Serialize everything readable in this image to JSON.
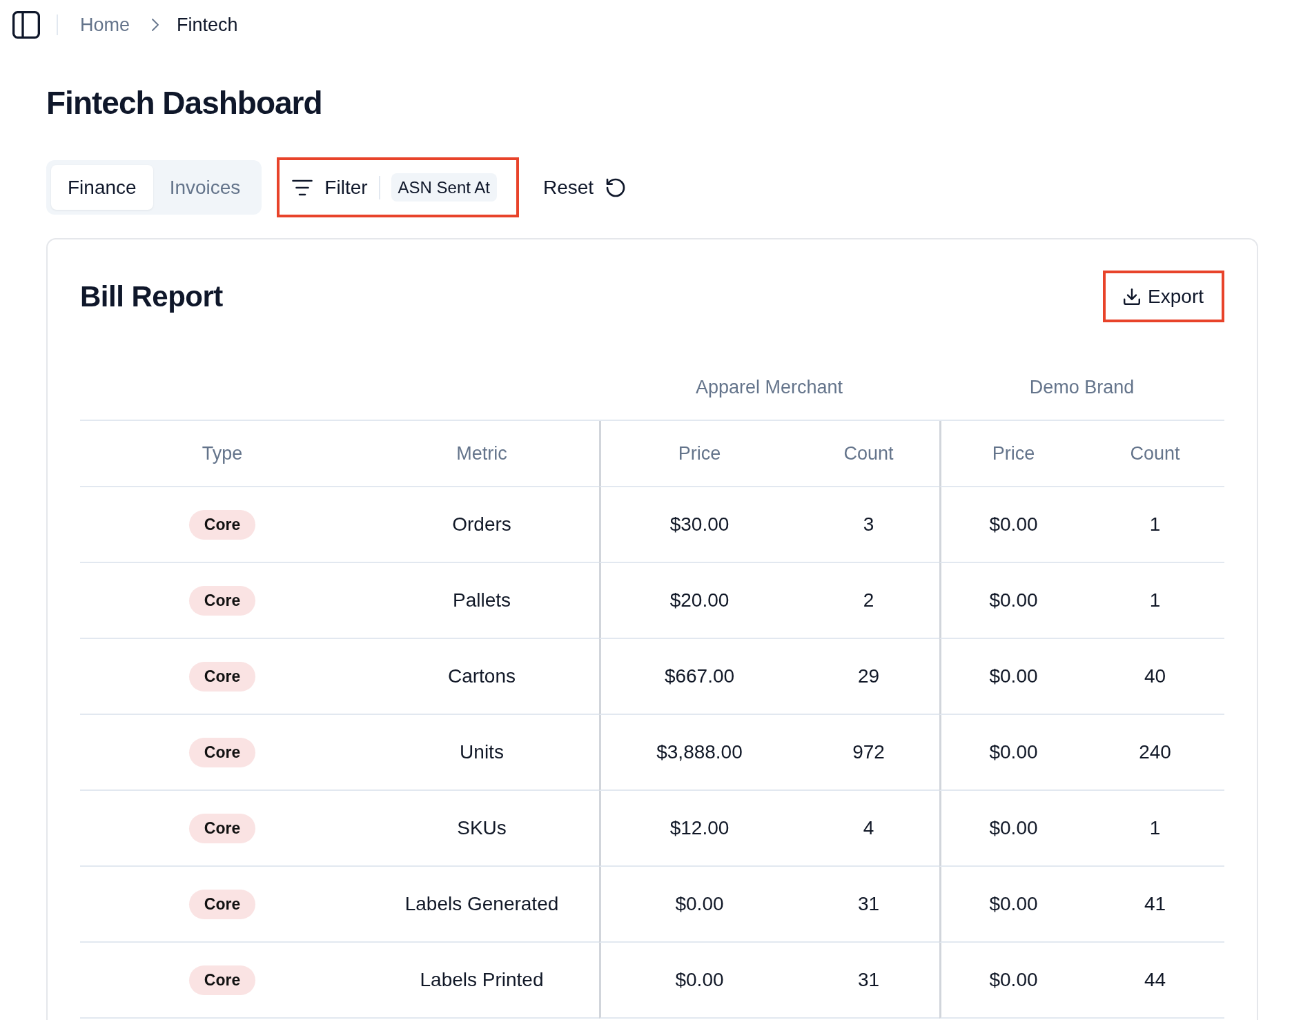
{
  "breadcrumb": [
    {
      "label": "Home",
      "current": false
    },
    {
      "label": "Fintech",
      "current": true
    }
  ],
  "page_title": "Fintech Dashboard",
  "tabs": [
    {
      "label": "Finance",
      "selected": true
    },
    {
      "label": "Invoices",
      "selected": false
    }
  ],
  "filter": {
    "label": "Filter",
    "chips": [
      "ASN Sent At"
    ],
    "highlighted": true
  },
  "reset_button": {
    "label": "Reset"
  },
  "report": {
    "title": "Bill Report",
    "export_button": {
      "label": "Export",
      "highlighted": true
    },
    "table": {
      "columns": [
        "Type",
        "Metric"
      ],
      "column_groups": [
        {
          "label": "Apparel Merchant",
          "columns": [
            "Price",
            "Count"
          ]
        },
        {
          "label": "Demo Brand",
          "columns": [
            "Price",
            "Count"
          ]
        }
      ],
      "rows": [
        {
          "type": "Core",
          "metric": "Orders",
          "values": [
            "$30.00",
            "3",
            "$0.00",
            "1"
          ]
        },
        {
          "type": "Core",
          "metric": "Pallets",
          "values": [
            "$20.00",
            "2",
            "$0.00",
            "1"
          ]
        },
        {
          "type": "Core",
          "metric": "Cartons",
          "values": [
            "$667.00",
            "29",
            "$0.00",
            "40"
          ]
        },
        {
          "type": "Core",
          "metric": "Units",
          "values": [
            "$3,888.00",
            "972",
            "$0.00",
            "240"
          ]
        },
        {
          "type": "Core",
          "metric": "SKUs",
          "values": [
            "$12.00",
            "4",
            "$0.00",
            "1"
          ]
        },
        {
          "type": "Core",
          "metric": "Labels Generated",
          "values": [
            "$0.00",
            "31",
            "$0.00",
            "41"
          ]
        },
        {
          "type": "Core",
          "metric": "Labels Printed",
          "values": [
            "$0.00",
            "31",
            "$0.00",
            "44"
          ]
        }
      ]
    }
  }
}
